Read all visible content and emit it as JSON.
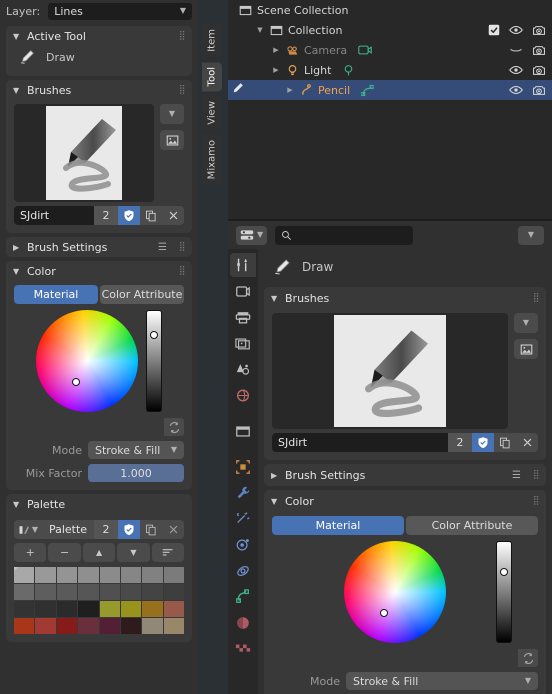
{
  "app": {
    "theme_bg": "#303030",
    "accent_blue": "#4772b3",
    "select_blue": "#364c78"
  },
  "sidebar": {
    "layer": {
      "label": "Layer:",
      "value": "Lines"
    },
    "tabs": [
      {
        "label": "Item",
        "active": false
      },
      {
        "label": "Tool",
        "active": true
      },
      {
        "label": "View",
        "active": false
      },
      {
        "label": "Mixamo",
        "active": false
      }
    ],
    "active_tool": {
      "title": "Active Tool",
      "tool_name": "Draw"
    },
    "brushes": {
      "title": "Brushes",
      "name": "SJdirt",
      "users": "2",
      "shield_icon": "shield-check-icon",
      "copy_icon": "duplicate-icon",
      "close_icon": "close-icon",
      "dropdown_icon": "chevron-down-icon",
      "image_icon": "image-icon"
    },
    "brush_settings": {
      "title": "Brush Settings"
    },
    "color": {
      "title": "Color",
      "tab_material": "Material",
      "tab_color_attribute": "Color Attribute",
      "active_tab": "Material",
      "primary_swatch": "#9a6450",
      "secondary_swatch": "#1f1f1f",
      "swap_icon": "swap-colors-icon",
      "mode_label": "Mode",
      "mode_value": "Stroke & Fill",
      "mix_label": "Mix Factor",
      "mix_value": "1.000"
    },
    "palette": {
      "title": "Palette",
      "name": "Palette",
      "users": "2",
      "add_label": "+",
      "remove_label": "−",
      "up_label": "▲",
      "down_label": "▼",
      "sort_icon": "sort-icon",
      "colors": [
        "#a8a8a8",
        "#999999",
        "#949494",
        "#8f8f8f",
        "#8b8b8b",
        "#868686",
        "#818181",
        "#7b7b7b",
        "#6a6a6a",
        "#5e5e5e",
        "#5a5a5a",
        "#565656",
        "#505050",
        "#4a4a4a",
        "#444444",
        "#3e3e3e",
        "#333333",
        "#303030",
        "#2b2b2b",
        "#1f1f1f",
        "#97992c",
        "#98931c",
        "#96701d",
        "#96594a",
        "#a8371a",
        "#a23a33",
        "#871b1a",
        "#69303c",
        "#521f34",
        "#2f1a1c",
        "#918877",
        "#99876a"
      ]
    }
  },
  "outliner": {
    "rows": [
      {
        "name": "Scene Collection",
        "indent": 0,
        "icon": "collection-icon",
        "expander": "",
        "style": "normal",
        "sub_icon": "",
        "right_icons": []
      },
      {
        "name": "Collection",
        "indent": 1,
        "icon": "collection-icon",
        "expander": "▼",
        "style": "normal",
        "sub_icon": "",
        "right_icons": [
          "checkbox-checked-icon",
          "eye-icon",
          "camera-icon"
        ]
      },
      {
        "name": "Camera",
        "indent": 2,
        "icon": "camera-data-icon",
        "expander": "▶",
        "style": "dim",
        "sub_icon": "camera-green-icon",
        "right_icons": [
          "eye-closed-icon",
          "camera-icon"
        ]
      },
      {
        "name": "Light",
        "indent": 2,
        "icon": "light-icon",
        "expander": "▶",
        "style": "normal",
        "sub_icon": "light-data-icon",
        "right_icons": [
          "eye-icon",
          "camera-icon"
        ]
      },
      {
        "name": "Pencil",
        "indent": 2,
        "icon": "grease-pencil-icon",
        "expander": "▶",
        "style": "orange",
        "sub_icon": "gp-data-icon",
        "right_icons": [
          "eye-icon",
          "camera-icon"
        ],
        "selected": true
      }
    ]
  },
  "properties": {
    "header": {
      "editor_type_icon": "properties-editor-icon",
      "search_placeholder": "",
      "search_value": "",
      "search_icon": "search-icon",
      "filter_icon": "chevron-down-icon"
    },
    "tabs": [
      {
        "name": "tool",
        "icon": "tool-icon",
        "color": "#cfcfcf",
        "active": true
      },
      {
        "name": "render",
        "icon": "render-icon",
        "color": "#bdbdbd",
        "active": false
      },
      {
        "name": "output",
        "icon": "output-printer-icon",
        "color": "#bdbdbd",
        "active": false
      },
      {
        "name": "view-layer",
        "icon": "view-layer-images-icon",
        "color": "#bdbdbd",
        "active": false
      },
      {
        "name": "scene",
        "icon": "scene-cone-icon",
        "color": "#bdbdbd",
        "active": false
      },
      {
        "name": "world",
        "icon": "world-globe-icon",
        "color": "#bd6a6a",
        "active": false
      },
      {
        "name": "collection",
        "icon": "collection-box-icon",
        "color": "#bdbdbd",
        "active": false
      },
      {
        "name": "object",
        "icon": "object-square-icon",
        "color": "#d08c42",
        "active": false
      },
      {
        "name": "modifiers",
        "icon": "wrench-icon",
        "color": "#5b83c4",
        "active": false
      },
      {
        "name": "effects",
        "icon": "sparkles-icon",
        "color": "#6d8fd0",
        "active": false
      },
      {
        "name": "particles",
        "icon": "particles-icon",
        "color": "#6d8fd0",
        "active": false
      },
      {
        "name": "physics",
        "icon": "physics-orbit-icon",
        "color": "#6d8fd0",
        "active": false
      },
      {
        "name": "constraints",
        "icon": "constraints-icon",
        "color": "#3fb58a",
        "active": false
      },
      {
        "name": "material",
        "icon": "material-sphere-icon",
        "color": "#b05a64",
        "active": false
      },
      {
        "name": "texture",
        "icon": "texture-checker-icon",
        "color": "#b05a64",
        "active": false
      }
    ],
    "active_tool": {
      "tool_name": "Draw"
    },
    "brushes": {
      "title": "Brushes",
      "name": "SJdirt",
      "users": "2"
    },
    "brush_settings": {
      "title": "Brush Settings"
    },
    "color": {
      "title": "Color",
      "tab_material": "Material",
      "tab_color_attribute": "Color Attribute",
      "primary_swatch": "#9a6450",
      "secondary_swatch": "#1f1f1f",
      "mode_label": "Mode",
      "mode_value": "Stroke & Fill"
    }
  }
}
